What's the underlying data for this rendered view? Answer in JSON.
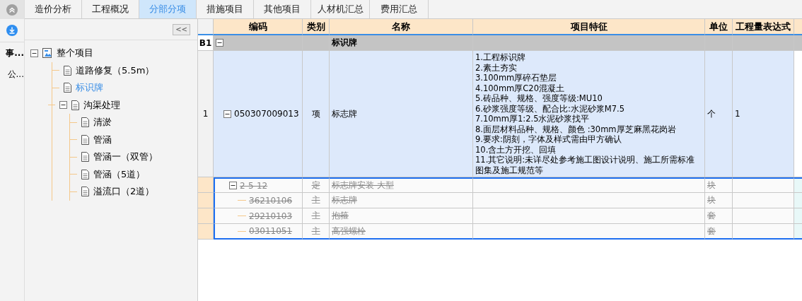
{
  "tabs": [
    {
      "label": "造价分析",
      "selected": false
    },
    {
      "label": "工程概况",
      "selected": false
    },
    {
      "label": "分部分项",
      "selected": true
    },
    {
      "label": "措施项目",
      "selected": false
    },
    {
      "label": "其他项目",
      "selected": false
    },
    {
      "label": "人材机汇总",
      "selected": false
    },
    {
      "label": "费用汇总",
      "selected": false
    }
  ],
  "side_strip": {
    "items": [
      {
        "label": "事...",
        "bold": true
      },
      {
        "label": "公...",
        "bold": false
      }
    ]
  },
  "tree": {
    "collapse_button": "<<",
    "nodes": [
      {
        "label": "整个项目",
        "kind": "root",
        "expanded": true,
        "selected": false,
        "children": [
          {
            "label": "道路修复（5.5m）",
            "kind": "doc",
            "selected": false
          },
          {
            "label": "标识牌",
            "kind": "doc",
            "selected": true
          },
          {
            "label": "沟渠处理",
            "kind": "doc",
            "expanded": true,
            "selected": false,
            "children": [
              {
                "label": "清淤",
                "kind": "doc",
                "selected": false
              },
              {
                "label": "管涵",
                "kind": "doc",
                "selected": false
              },
              {
                "label": "管涵一（双管）",
                "kind": "doc",
                "selected": false
              },
              {
                "label": "管涵（5道）",
                "kind": "doc",
                "selected": false
              },
              {
                "label": "溢流口（2道）",
                "kind": "doc",
                "selected": false
              }
            ]
          }
        ]
      }
    ]
  },
  "table": {
    "columns": [
      "编码",
      "类别",
      "名称",
      "项目特征",
      "单位",
      "工程量表达式"
    ],
    "rows": [
      {
        "kind": "section",
        "number": "B1",
        "expanded": true,
        "name": "标识牌"
      },
      {
        "kind": "item",
        "number": "1",
        "expanded": true,
        "code": "050307009013",
        "type": "项",
        "name": "标志牌",
        "features": "1.工程标识牌\n2.素土夯实\n3.100mm厚碎石垫层\n4.100mm厚C20混凝土\n5.砖品种、规格、强度等级:MU10\n6.砂浆强度等级、配合比:水泥砂浆M7.5\n7.10mm厚1:2.5水泥砂浆找平\n8.面层材料品种、规格、颜色 :30mm厚芝麻黑花岗岩\n9.要求:阴刻，字体及样式需由甲方确认\n10.含土方开挖、回填\n11.其它说明:未详尽处参考施工图设计说明、施工所需标准图集及施工规范等",
        "unit": "个",
        "quantity": "1",
        "struck": false,
        "selected": false
      },
      {
        "kind": "quota",
        "expanded": true,
        "code": "2-5-12",
        "type": "定",
        "name": "标志牌安装 大型",
        "unit": "块",
        "struck": true,
        "selected": true
      },
      {
        "kind": "material",
        "code": "36210106",
        "type": "主",
        "name": "标志牌",
        "unit": "块",
        "struck": true,
        "selected": true
      },
      {
        "kind": "material",
        "code": "29210103",
        "type": "主",
        "name": "抱箍",
        "unit": "套",
        "struck": true,
        "selected": true
      },
      {
        "kind": "material",
        "code": "03011051",
        "type": "主",
        "name": "高强螺栓",
        "unit": "套",
        "struck": true,
        "selected": true
      }
    ]
  }
}
